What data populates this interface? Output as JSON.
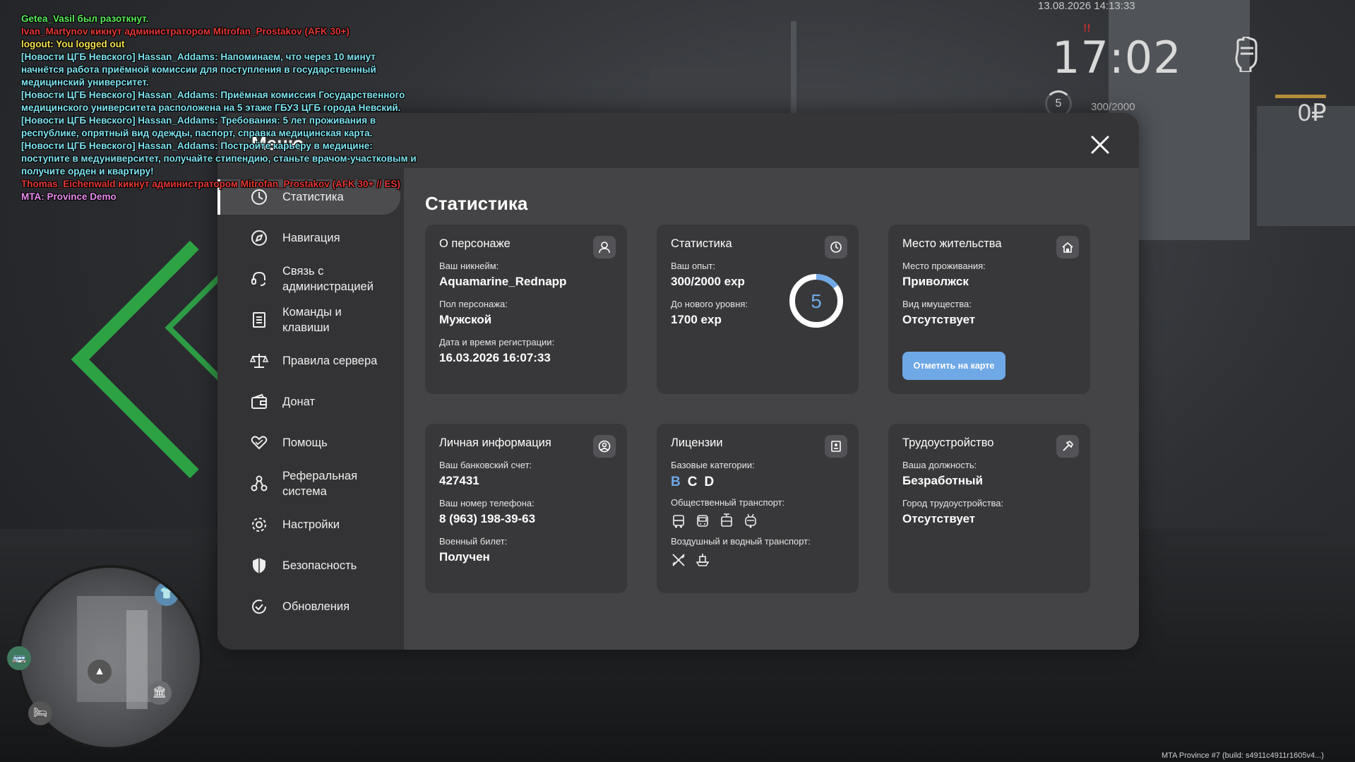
{
  "chat": [
    {
      "text": "Getea_Vasil был разоткнут.",
      "color": "#5cf05c"
    },
    {
      "text": "Ivan_Martynov кикнут администратором Mitrofan_Prostakov (AFK 30+)",
      "color": "#e53935"
    },
    {
      "text": "logout: You logged out",
      "color": "#f4e04d"
    },
    {
      "text": "[Новости ЦГБ Невского] Hassan_Addams: Напоминаем, что через 10 минут начнётся работа приёмной комиссии для поступления в государственный медицинский университет.",
      "color": "#7fe3f0"
    },
    {
      "text": "[Новости ЦГБ Невского] Hassan_Addams: Приёмная комиссия Государственного медицинского университета расположена на 5 этаже ГБУЗ ЦГБ города Невский.",
      "color": "#7fe3f0"
    },
    {
      "text": "[Новости ЦГБ Невского] Hassan_Addams: Требования: 5 лет проживания в республике, опрятный вид одежды, паспорт, справка медицинская карта.",
      "color": "#7fe3f0"
    },
    {
      "text": "[Новости ЦГБ Невского] Hassan_Addams: Постройте карьеру в медицине: поступите в медуниверситет, получайте стипендию, станьте врачом-участковым и получите орден и квартиру!",
      "color": "#7fe3f0"
    },
    {
      "text": "Thomas_Eichenwald кикнут администратором Mitrofan_Prostakov (AFK 30+ // ES)",
      "color": "#e53935"
    },
    {
      "text": "MTA: Province Demo",
      "color": "#e98ef0"
    }
  ],
  "hud": {
    "date": "13.08.2026 14:13:33",
    "time": "17:02",
    "level": "5",
    "exp": "300/2000",
    "money": "0₽",
    "alert": "!!"
  },
  "menu": {
    "title": "Меню",
    "section_title": "Статистика"
  },
  "sidebar": [
    {
      "label": "Статистика",
      "icon": "clock-icon"
    },
    {
      "label": "Навигация",
      "icon": "compass-icon"
    },
    {
      "label": "Связь с администрацией",
      "icon": "headset-icon"
    },
    {
      "label": "Команды и клавиши",
      "icon": "document-icon"
    },
    {
      "label": "Правила сервера",
      "icon": "scales-icon"
    },
    {
      "label": "Донат",
      "icon": "wallet-icon"
    },
    {
      "label": "Помощь",
      "icon": "heart-hands-icon"
    },
    {
      "label": "Реферальная система",
      "icon": "referral-icon"
    },
    {
      "label": "Настройки",
      "icon": "gear-icon"
    },
    {
      "label": "Безопасность",
      "icon": "shield-icon"
    },
    {
      "label": "Обновления",
      "icon": "update-icon"
    }
  ],
  "cards": {
    "character": {
      "title": "О персонаже",
      "nick_label": "Ваш никнейм:",
      "nick": "Aquamarine_Rednapp",
      "gender_label": "Пол персонажа:",
      "gender": "Мужской",
      "reg_label": "Дата и время регистрации:",
      "reg": "16.03.2026 16:07:33"
    },
    "stats": {
      "title": "Статистика",
      "exp_label": "Ваш опыт:",
      "exp": "300/2000 exp",
      "next_label": "До нового уровня:",
      "next": "1700 exp",
      "level": "5",
      "progress": 0.15
    },
    "residence": {
      "title": "Место жительства",
      "place_label": "Место проживания:",
      "place": "Приволжск",
      "property_label": "Вид имущества:",
      "property": "Отсутствует",
      "map_button": "Отметить на карте"
    },
    "personal": {
      "title": "Личная информация",
      "bank_label": "Ваш банковский счет:",
      "bank": "427431",
      "phone_label": "Ваш номер телефона:",
      "phone": "8 (963) 198-39-63",
      "military_label": "Военный билет:",
      "military": "Получен"
    },
    "licenses": {
      "title": "Лицензии",
      "base_label": "Базовые категории:",
      "categories": [
        "B",
        "C",
        "D"
      ],
      "public_label": "Общественный транспорт:",
      "air_label": "Воздушный и водный транспорт:"
    },
    "job": {
      "title": "Трудоустройство",
      "position_label": "Ваша должность:",
      "position": "Безработный",
      "city_label": "Город трудоустройства:",
      "city": "Отсутствует"
    }
  },
  "build": "MTA Province #7 (build: s4911c4911r1605v4...)",
  "colors": {
    "accent": "#6fa8e6",
    "category_active": "#6fa8e6"
  }
}
